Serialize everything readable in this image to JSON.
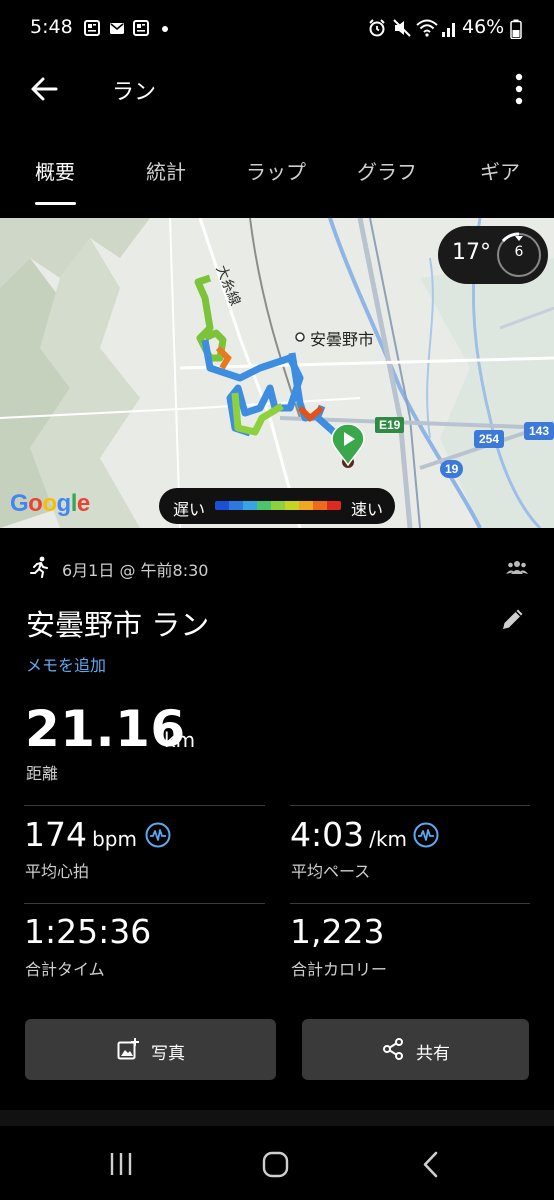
{
  "status_bar": {
    "time": "5:48",
    "battery": "46%",
    "left_icons": [
      "news-icon",
      "mail-icon",
      "news-icon"
    ],
    "right_icons": [
      "alarm-icon",
      "mute-icon",
      "wifi-icon",
      "signal-icon",
      "battery-icon"
    ]
  },
  "app_bar": {
    "title": "ラン"
  },
  "tabs": [
    {
      "label": "概要",
      "active": true
    },
    {
      "label": "統計",
      "active": false
    },
    {
      "label": "ラップ",
      "active": false
    },
    {
      "label": "グラフ",
      "active": false
    },
    {
      "label": "ギア",
      "active": false
    }
  ],
  "map": {
    "place_label": "安曇野市",
    "rail_label": "大糸線",
    "road_badges": [
      "E19",
      "254",
      "143",
      "19"
    ],
    "weather": {
      "temperature": "17°",
      "wind": "6"
    },
    "legend": {
      "slow": "遅い",
      "fast": "速い",
      "colors": [
        "#1b4fd4",
        "#2c7ae0",
        "#35a6e3",
        "#4cc36d",
        "#8ed13e",
        "#c6d424",
        "#f0a91e",
        "#ee6a1c",
        "#dd2b22"
      ]
    },
    "attribution": "Google"
  },
  "summary": {
    "datetime": "6月1日 @ 午前8:30",
    "title": "安曇野市 ラン",
    "memo_link": "メモを追加",
    "distance": {
      "value": "21.16",
      "unit": "km",
      "label": "距離"
    },
    "stats": [
      {
        "value": "174",
        "unit": "bpm",
        "label": "平均心拍",
        "has_icon": true
      },
      {
        "value": "4:03",
        "unit": "/km",
        "label": "平均ペース",
        "has_icon": true
      },
      {
        "value": "1:25:36",
        "unit": "",
        "label": "合計タイム",
        "has_icon": false
      },
      {
        "value": "1,223",
        "unit": "",
        "label": "合計カロリー",
        "has_icon": false
      }
    ]
  },
  "buttons": {
    "photo": "写真",
    "share": "共有"
  },
  "nav_bar": [
    "recents-button",
    "home-button",
    "back-button"
  ]
}
